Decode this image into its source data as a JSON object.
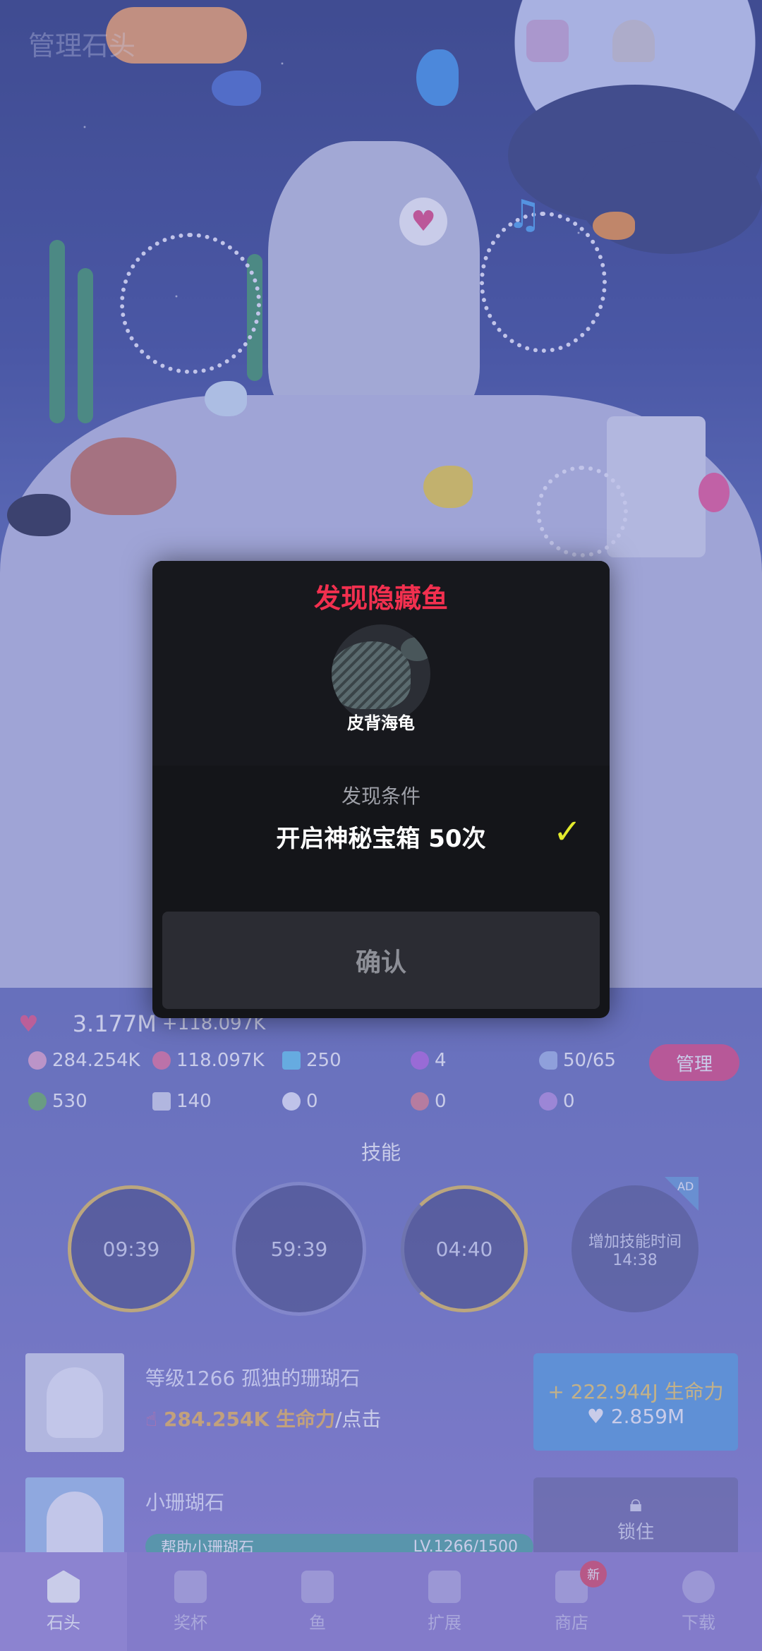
{
  "header": {
    "title": "管理石头"
  },
  "stats": {
    "total_life": "3.177M",
    "total_rate": "+118.097K",
    "tap_life": "284.254K",
    "auto_life": "118.097K",
    "gems": "250",
    "purple_orbs": "4",
    "fish_count": "50/65",
    "manage_label": "管理",
    "seaweed": "530",
    "stone": "140",
    "shells": "0",
    "eggs": "0",
    "seahorse": "0"
  },
  "skills": {
    "title": "技能",
    "timers": [
      "09:39",
      "59:39",
      "04:40"
    ],
    "ad_skill_label": "增加技能时间",
    "ad_skill_time": "14:38",
    "ad_tag": "AD"
  },
  "rows": [
    {
      "title": "等级1266 孤独的珊瑚石",
      "sub_value": "284.254K 生命力",
      "sub_suffix": "/点击",
      "upgrade_line1": "+ 222.944J 生命力",
      "upgrade_line2": "♥ 2.859M"
    },
    {
      "title": "小珊瑚石",
      "progress_left": "帮助小珊瑚石",
      "progress_right": "LV.1266/1500",
      "locked_label": "锁住"
    }
  ],
  "tabs": [
    {
      "label": "石头",
      "icon": "stone-icon",
      "active": true
    },
    {
      "label": "奖杯",
      "icon": "trophy-icon"
    },
    {
      "label": "鱼",
      "icon": "fish-icon"
    },
    {
      "label": "扩展",
      "icon": "expand-icon"
    },
    {
      "label": "商店",
      "icon": "shop-icon",
      "badge": "新"
    },
    {
      "label": "下载",
      "icon": "download-icon"
    }
  ],
  "modal": {
    "title": "发现隐藏鱼",
    "fish_name": "皮背海龟",
    "condition_label": "发现条件",
    "condition_text": "开启神秘宝箱 50次",
    "confirm_label": "确认",
    "colors": {
      "title": "#f2304f",
      "check": "#e2ea2c"
    }
  }
}
